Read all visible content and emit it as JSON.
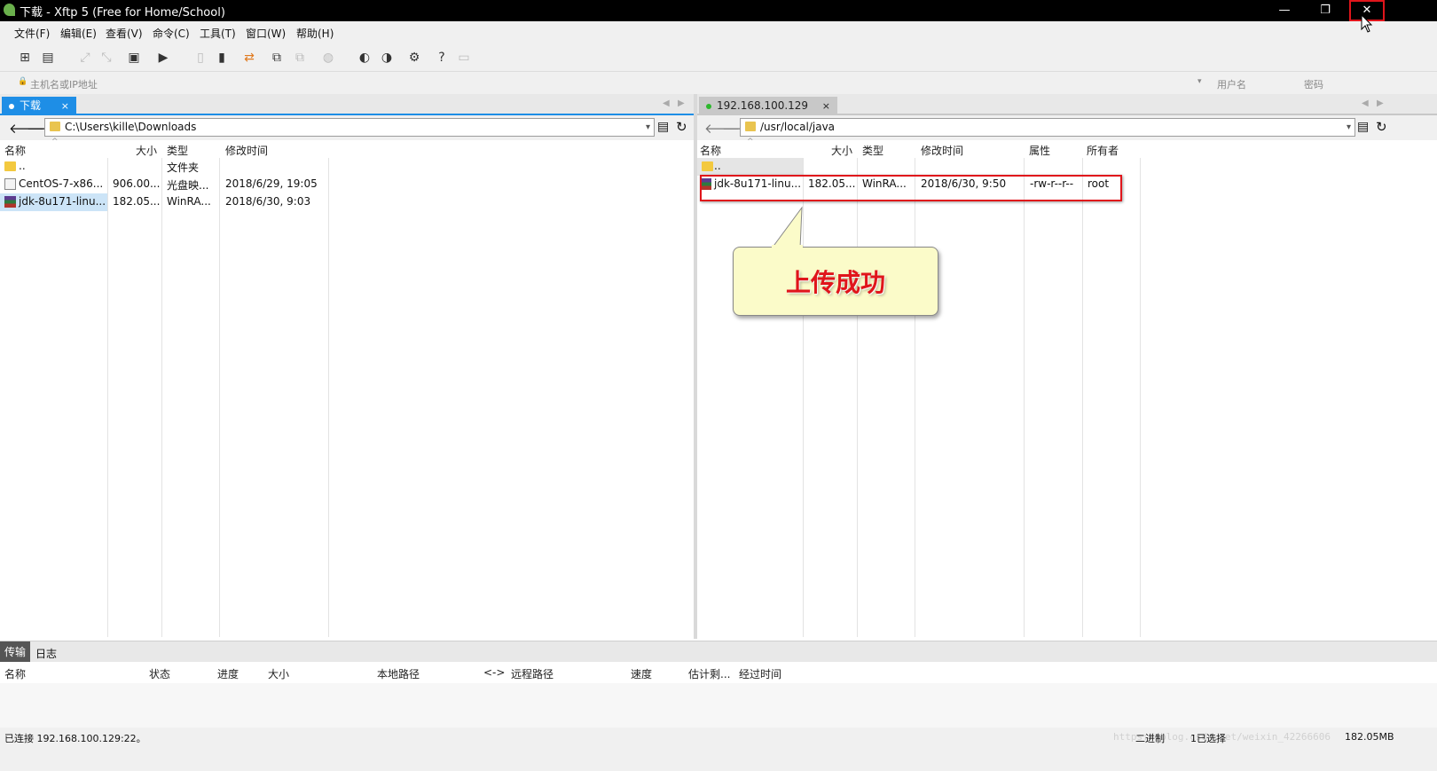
{
  "window": {
    "title": "下载 - Xftp 5 (Free for Home/School)",
    "minimize": "—",
    "restore": "❐",
    "close": "✕"
  },
  "menu": [
    "文件(F)",
    "编辑(E)",
    "查看(V)",
    "命令(C)",
    "工具(T)",
    "窗口(W)",
    "帮助(H)"
  ],
  "address": {
    "host_placeholder": "主机名或IP地址",
    "user_placeholder": "用户名",
    "pass_placeholder": "密码"
  },
  "left": {
    "tab": "下载",
    "tab_close": "×",
    "path": "C:\\Users\\kille\\Downloads",
    "columns": [
      "名称",
      "大小",
      "类型",
      "修改时间"
    ],
    "rows": [
      {
        "icon": "folder-icon",
        "name": "..",
        "size": "",
        "type": "文件夹",
        "mtime": ""
      },
      {
        "icon": "disc-image-icon",
        "name": "CentOS-7-x86...",
        "size": "906.00...",
        "type": "光盘映...",
        "mtime": "2018/6/29, 19:05"
      },
      {
        "icon": "rar-archive-icon",
        "name": "jdk-8u171-linu...",
        "size": "182.05...",
        "type": "WinRA...",
        "mtime": "2018/6/30, 9:03"
      }
    ]
  },
  "right": {
    "tab": "192.168.100.129",
    "tab_close": "×",
    "path": "/usr/local/java",
    "columns": [
      "名称",
      "大小",
      "类型",
      "修改时间",
      "属性",
      "所有者"
    ],
    "rows": [
      {
        "icon": "folder-icon",
        "name": "..",
        "size": "",
        "type": "",
        "mtime": "",
        "attr": "",
        "owner": ""
      },
      {
        "icon": "rar-archive-icon",
        "name": "jdk-8u171-linu...",
        "size": "182.05...",
        "type": "WinRA...",
        "mtime": "2018/6/30, 9:50",
        "attr": "-rw-r--r--",
        "owner": "root"
      }
    ]
  },
  "callout": {
    "text": "上传成功"
  },
  "transfer": {
    "tabs": [
      "传输",
      "日志"
    ],
    "columns": [
      "名称",
      "状态",
      "进度",
      "大小",
      "本地路径",
      "<->",
      "远程路径",
      "速度",
      "估计剩...",
      "经过时间"
    ]
  },
  "status": {
    "connection": "已连接 192.168.100.129:22。",
    "mode": "二进制",
    "selection": "1已选择",
    "size": "182.05MB",
    "watermark": "https://blog.csdn.net/weixin_42266606"
  },
  "colors": {
    "tab_active": "#1e8ee6",
    "highlight_box": "#e0151b",
    "connected_dot": "#2db82d"
  }
}
